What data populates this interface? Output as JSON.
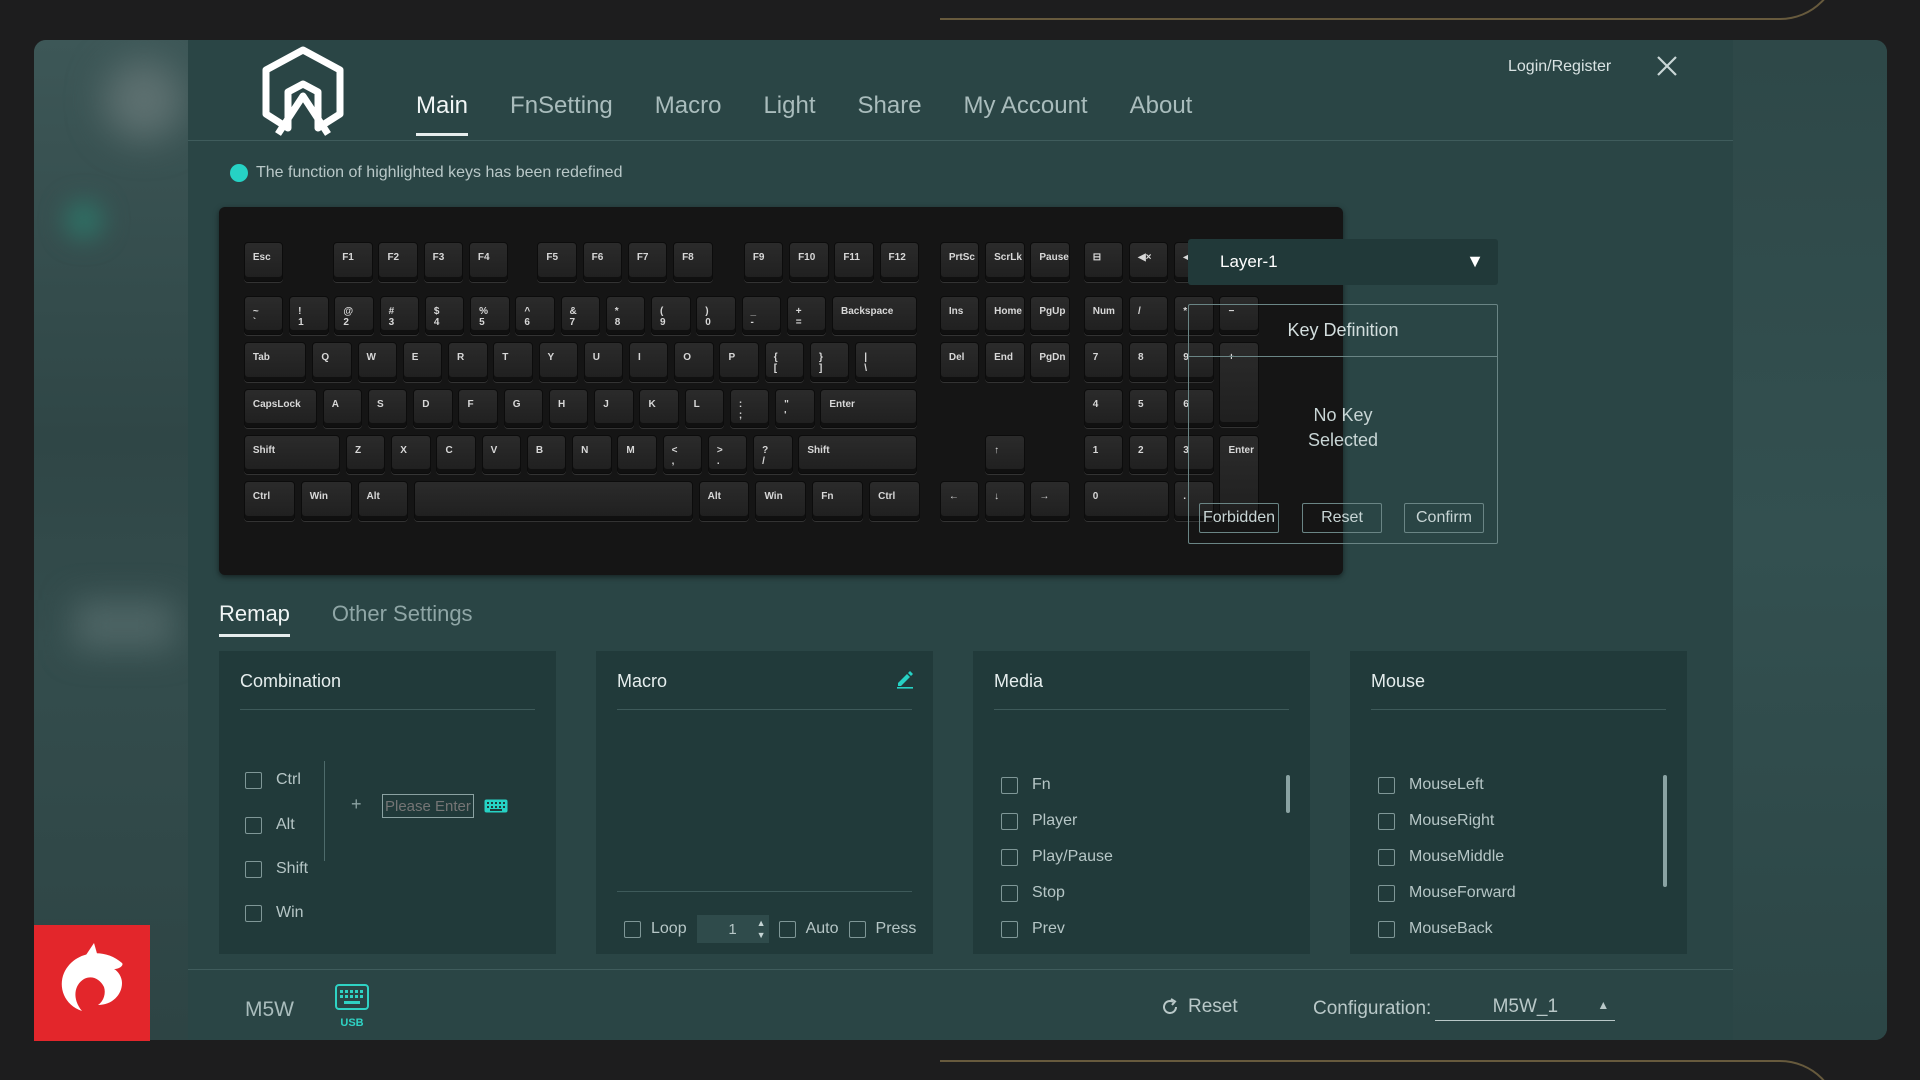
{
  "header": {
    "nav": [
      "Main",
      "FnSetting",
      "Macro",
      "Light",
      "Share",
      "My Account",
      "About"
    ],
    "active_nav": "Main",
    "login": "Login/Register"
  },
  "notice": "The function of highlighted keys has been redefined",
  "keyboard": {
    "keys": {
      "esc": "Esc",
      "f1": "F1",
      "f2": "F2",
      "f3": "F3",
      "f4": "F4",
      "f5": "F5",
      "f6": "F6",
      "f7": "F7",
      "f8": "F8",
      "f9": "F9",
      "f10": "F10",
      "f11": "F11",
      "f12": "F12",
      "prtsc": "PrtSc",
      "scrlk": "ScrLk",
      "pause": "Pause",
      "calc": "⊟",
      "mute": "◀×",
      "voldown": "◀)",
      "volup": "◀))",
      "tilde": "~\n`",
      "n1": "!\n1",
      "n2": "@\n2",
      "n3": "#\n3",
      "n4": "$\n4",
      "n5": "%\n5",
      "n6": "^\n6",
      "n7": "&\n7",
      "n8": "*\n8",
      "n9": "(\n9",
      "n0": ")\n0",
      "minus": "_\n-",
      "equal": "+\n=",
      "backspace": "Backspace",
      "ins": "Ins",
      "home": "Home",
      "pgup": "PgUp",
      "num": "Num",
      "npdiv": "/",
      "npmul": "*",
      "npsub": "−",
      "tab": "Tab",
      "q": "Q",
      "w": "W",
      "e": "E",
      "r": "R",
      "t": "T",
      "y": "Y",
      "u": "U",
      "i": "I",
      "o": "O",
      "p": "P",
      "lbr": "{\n[",
      "rbr": "}\n]",
      "bslash": "|\n\\",
      "del": "Del",
      "end": "End",
      "pgdn": "PgDn",
      "np7": "7",
      "np8": "8",
      "np9": "9",
      "npadd": "+",
      "caps": "CapsLock",
      "a": "A",
      "s": "S",
      "d": "D",
      "f": "F",
      "g": "G",
      "h": "H",
      "j": "J",
      "k": "K",
      "l": "L",
      "semi": ":\n;",
      "quote": "\"\n'",
      "enter": "Enter",
      "np4": "4",
      "np5": "5",
      "np6": "6",
      "lshift": "Shift",
      "z": "Z",
      "x": "X",
      "c": "C",
      "v": "V",
      "b": "B",
      "n": "N",
      "m": "M",
      "comma": "<\n,",
      "period": ">\n.",
      "slash": "?\n/",
      "rshift": "Shift",
      "up": "↑",
      "np1": "1",
      "np2": "2",
      "np3": "3",
      "npenter": "Enter",
      "lctrl": "Ctrl",
      "lwin": "Win",
      "lalt": "Alt",
      "space": "",
      "ralt": "Alt",
      "rwin": "Win",
      "fn": "Fn",
      "rctrl": "Ctrl",
      "left": "←",
      "down": "↓",
      "right": "→",
      "np0": "0",
      "npdot": "."
    }
  },
  "layer": {
    "selected": "Layer-1"
  },
  "key_definition": {
    "title": "Key Definition",
    "empty_line1": "No Key",
    "empty_line2": "Selected",
    "forbidden": "Forbidden",
    "reset": "Reset",
    "confirm": "Confirm"
  },
  "subtabs": [
    "Remap",
    "Other Settings"
  ],
  "combination": {
    "title": "Combination",
    "mods": [
      "Ctrl",
      "Alt",
      "Shift",
      "Win"
    ],
    "plus": "+",
    "placeholder": "Please Enter"
  },
  "macro": {
    "title": "Macro",
    "loop": "Loop",
    "count": "1",
    "auto": "Auto",
    "press": "Press"
  },
  "media": {
    "title": "Media",
    "items": [
      "Fn",
      "Player",
      "Play/Pause",
      "Stop",
      "Prev"
    ]
  },
  "mouse": {
    "title": "Mouse",
    "items": [
      "MouseLeft",
      "MouseRight",
      "MouseMiddle",
      "MouseForward",
      "MouseBack"
    ]
  },
  "footer": {
    "device": "M5W",
    "usb": "USB",
    "reset": "Reset",
    "config_label": "Configuration:",
    "config_value": "M5W_1"
  },
  "colors": {
    "accent": "#26d2c4",
    "background": "#2a4545",
    "panel": "#213a3a",
    "brand_badge": "#e3262b"
  }
}
